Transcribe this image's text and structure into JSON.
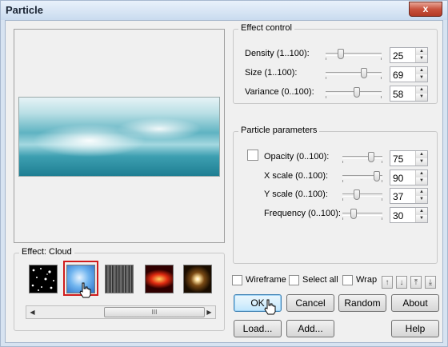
{
  "window": {
    "title": "Particle",
    "close_glyph": "x"
  },
  "effects": {
    "label": "Effect: Cloud",
    "thumbnails": [
      "stars",
      "cloud",
      "smoke",
      "fire",
      "flare"
    ],
    "selected": "cloud",
    "scroll_grip": "III"
  },
  "effect_control": {
    "label": "Effect control",
    "rows": [
      {
        "label": "Density (1..100):",
        "value": "25"
      },
      {
        "label": "Size (1..100):",
        "value": "69"
      },
      {
        "label": "Variance (0..100):",
        "value": "58"
      }
    ]
  },
  "particle_params": {
    "label": "Particle parameters",
    "rows": [
      {
        "label": "Opacity (0..100):",
        "value": "75"
      },
      {
        "label": "X scale (0..100):",
        "value": "90"
      },
      {
        "label": "Y scale (0..100):",
        "value": "37"
      },
      {
        "label": "Frequency (0..100):",
        "value": "30"
      }
    ]
  },
  "options": {
    "wireframe": "Wireframe",
    "select_all": "Select all",
    "wrap": "Wrap"
  },
  "buttons": {
    "ok": "OK",
    "cancel": "Cancel",
    "random": "Random",
    "about": "About",
    "load": "Load...",
    "add": "Add...",
    "help": "Help"
  },
  "arrows": [
    "↑",
    "↓",
    "⤒",
    "⤓"
  ]
}
